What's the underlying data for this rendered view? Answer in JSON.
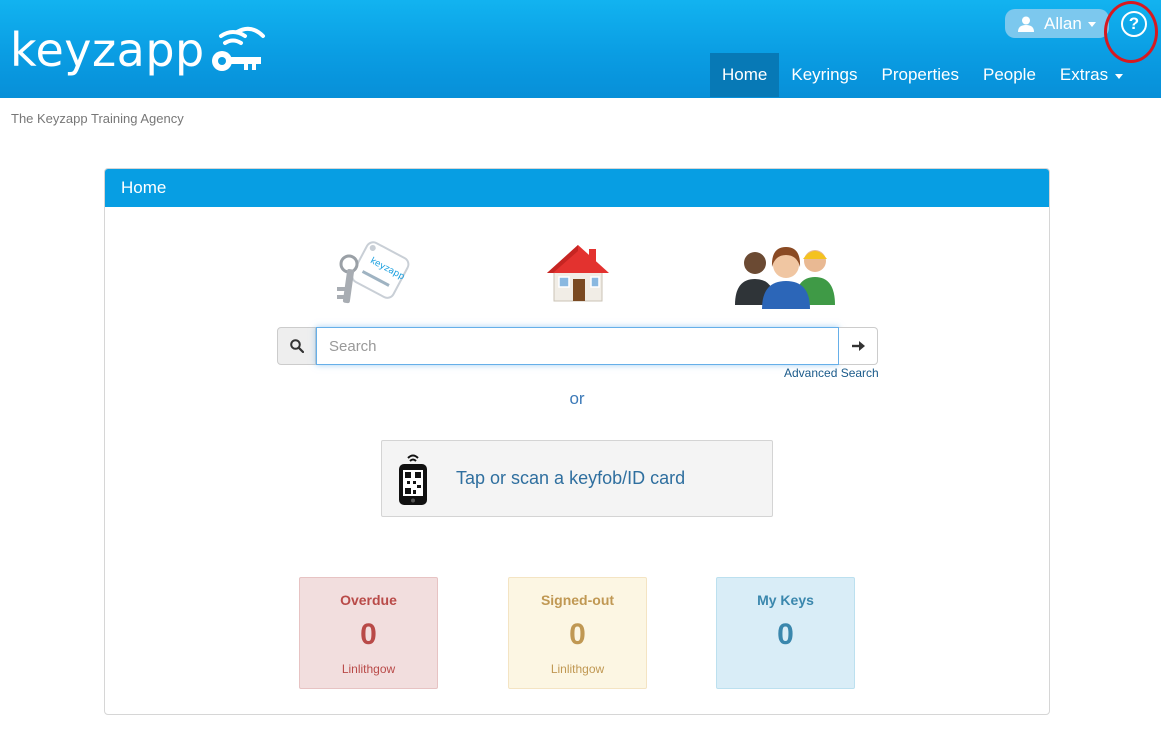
{
  "brand": {
    "logo_text": "keyzapp"
  },
  "header": {
    "user_name": "Allan",
    "help_symbol": "?",
    "nav": [
      {
        "label": "Home",
        "active": true
      },
      {
        "label": "Keyrings",
        "active": false
      },
      {
        "label": "Properties",
        "active": false
      },
      {
        "label": "People",
        "active": false
      },
      {
        "label": "Extras",
        "active": false,
        "dropdown": true
      }
    ]
  },
  "agency_name": "The Keyzapp Training Agency",
  "panel": {
    "title": "Home",
    "icons": [
      "keyring-icon",
      "house-icon",
      "people-icon"
    ],
    "search": {
      "placeholder": "Search",
      "value": ""
    },
    "advanced_search_label": "Advanced Search",
    "or_label": "or",
    "tap_label": "Tap or scan a keyfob/ID card",
    "stats": [
      {
        "title": "Overdue",
        "count": "0",
        "sub": "Linlithgow",
        "color": "#b94a48",
        "bg": "#f2dede",
        "border": "#e7c3c3"
      },
      {
        "title": "Signed-out",
        "count": "0",
        "sub": "Linlithgow",
        "color": "#c09853",
        "bg": "#fcf6e3",
        "border": "#f4e4c3"
      },
      {
        "title": "My Keys",
        "count": "0",
        "sub": "",
        "color": "#3a87ad",
        "bg": "#d9edf7",
        "border": "#bce0ef"
      }
    ]
  },
  "colors": {
    "header": "#0a9de3",
    "nav_active": "#0779b6",
    "panel_heading": "#079ee3",
    "help_highlight": "#d71920"
  }
}
